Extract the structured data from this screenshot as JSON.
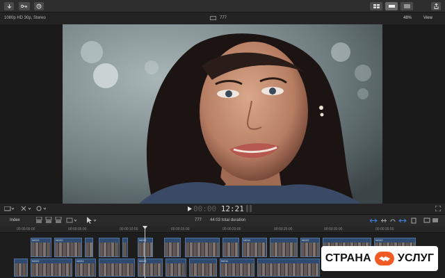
{
  "toolbar": {
    "left_icons": [
      "import-icon",
      "keywords-icon",
      "background-tasks-icon"
    ],
    "right_icons": [
      "browser-toggle-icon",
      "timeline-toggle-icon",
      "inspector-toggle-icon",
      "share-icon"
    ]
  },
  "viewer": {
    "format": "1080p HD 30p, Stereo",
    "project": "777",
    "zoom": "48%",
    "view": "View",
    "timecode_dim": "00:00",
    "timecode": "12:21"
  },
  "timeline": {
    "index_label": "Index",
    "project": "777",
    "duration": "44:03 total duration",
    "ruler": [
      "00:00:00:00",
      "00:00:05:00",
      "00:00:10:00",
      "00:00:15:00",
      "00:00:20:00",
      "00:00:25:00",
      "00:00:30:00",
      "00:00:35:00"
    ],
    "clip_label": "NG22",
    "clip_label_alt": "NG11"
  },
  "watermark": {
    "left": "СТРАНА",
    "right": "УСЛУГ"
  },
  "colors": {
    "clip_fill": "#2e4a6e",
    "clip_border": "#4f74a2",
    "accent_orange": "#f25a24"
  }
}
